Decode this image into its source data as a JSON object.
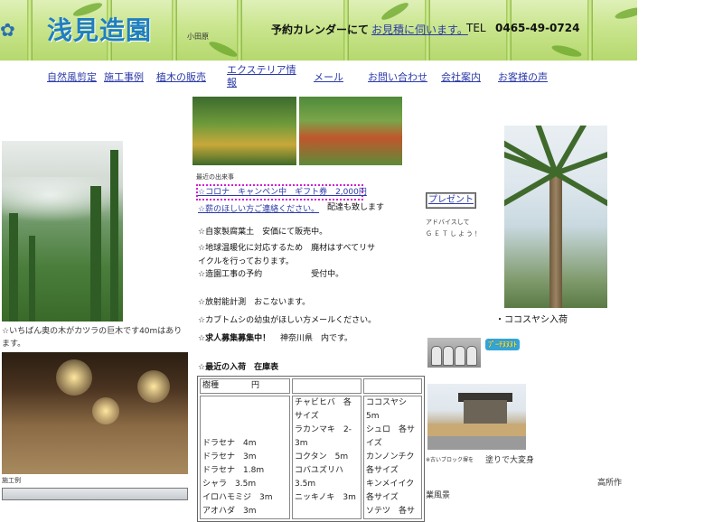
{
  "header": {
    "site_title": "浅見造園",
    "region": "小田原",
    "reserve_text": "予約カレンダーにて",
    "reserve_link": "お見積に伺います。",
    "tel_label": "TEL",
    "tel_number": "0465-49-0724"
  },
  "nav": {
    "items": [
      "自然風剪定",
      "施工事例",
      "植木の販売",
      "エクステリア情報",
      "メール",
      "お問い合わせ",
      "会社案内",
      "お客様の声"
    ]
  },
  "left": {
    "forest_caption": "☆いちばん奥の木がカツラの巨木です40mはあります。",
    "bottom_caption": "施工例"
  },
  "center": {
    "recent_label": "最近の出来事",
    "campaign_text": "☆コロナ　キャンペン中　ギフト券　2,000円",
    "firewood_link": "☆薪のほしい方ご連絡ください。",
    "firewood_tail": "配達も致します",
    "lines": [
      "☆自家製腐葉土　安価にて販売中。",
      "☆地球温暖化に対応するため　廃材はすべてリサイクルを行っております。",
      "☆造園工事の予約　　　　　　受付中。",
      "☆放射能計測　おこないます。",
      "☆カブトムシの幼虫がほしい方メールください。"
    ],
    "recruit_bold": "☆求人募集募集中！",
    "recruit_text": "神奈川県　内です。",
    "stock_title": "☆最近の入荷　在庫表",
    "stock_table": {
      "headers": [
        "樹種　　　　円",
        "",
        ""
      ],
      "columns": [
        [
          "ドラセナ　4m",
          "ドラセナ　3m",
          "ドラセナ　1.8m",
          "シャラ　3.5m",
          "イロハモミジ　3m",
          "アオハダ　3m"
        ],
        [
          "チャビヒバ　各サイズ",
          "ラカンマキ　2-3m",
          "コクタン　5m",
          "コバユズリハ　3.5m",
          "ニッキノキ　3m"
        ],
        [
          "ココスヤシ　5m",
          "シュロ　各サイズ",
          "カンノンチク　各サイズ",
          "キンメイイク　各サイズ",
          "ソテツ　各サ"
        ]
      ]
    }
  },
  "right": {
    "present_button": "プレゼント",
    "advice_line1": "アドバイスして",
    "advice_line2": "ＧＥＴしよう！",
    "palm_caption": "・ココスヤシ入荷",
    "badge_text": "ﾌﾞｰﾁﾇﾇﾇﾄ",
    "house_caption_small": "※古いブロック塀を",
    "house_caption": "塗りで大変身",
    "bottom_right1": "高所作",
    "bottom_right2": "業風景"
  }
}
